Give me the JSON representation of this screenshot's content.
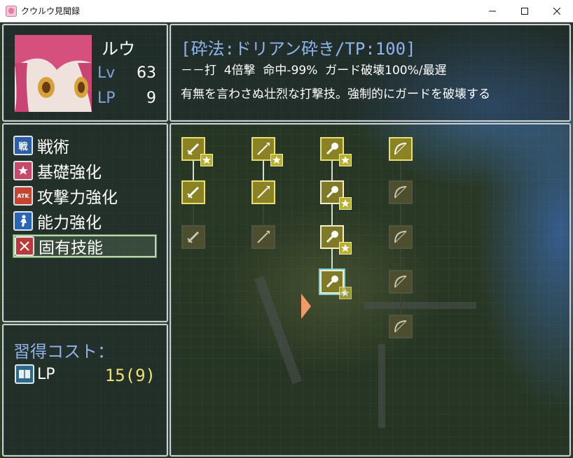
{
  "window": {
    "title": "クウルウ見聞録"
  },
  "character": {
    "name": "ルウ",
    "lv_label": "Lv",
    "lv_value": "63",
    "lp_label": "LP",
    "lp_value": "9"
  },
  "skill": {
    "title": "[砕法:ドリアン砕き/TP:100]",
    "stats": "－－打  4倍撃  命中-99%  ガード破壊100%/最遅",
    "description": "有無を言わさぬ壮烈な打撃技。強制的にガードを破壊する"
  },
  "categories": [
    {
      "label": "戦術",
      "icon_text": "戦",
      "icon": "tactics-icon",
      "color": "#2c5da8"
    },
    {
      "label": "基礎強化",
      "icon_text": "",
      "icon": "basic-enhance-icon",
      "color": "#c8486a"
    },
    {
      "label": "攻撃力強化",
      "icon_text": "ATK",
      "icon": "attack-enhance-icon",
      "color": "#c84432"
    },
    {
      "label": "能力強化",
      "icon_text": "",
      "icon": "ability-enhance-icon",
      "color": "#2a66b8"
    },
    {
      "label": "固有技能",
      "icon_text": "",
      "icon": "unique-skill-icon",
      "color": "#b83a3a"
    }
  ],
  "selected_category": "固有技能",
  "cost": {
    "title": "習得コスト：",
    "label": "LP",
    "value": "15(9)"
  },
  "tree": {
    "columns": [
      {
        "weapon": "sword",
        "nodes": [
          "learned-star",
          "learned",
          "dark"
        ]
      },
      {
        "weapon": "spear",
        "nodes": [
          "learned-star",
          "learned",
          "dark"
        ]
      },
      {
        "weapon": "mace",
        "nodes": [
          "learned-star",
          "lit-star",
          "lit-star",
          "cursor-star"
        ]
      },
      {
        "weapon": "bow",
        "nodes": [
          "learned",
          "dark",
          "dark",
          "dark",
          "dark"
        ]
      }
    ]
  },
  "colors": {
    "accent_text": "#8fb4ec",
    "cost_value": "#f0e070",
    "cursor_arrow": "#f09a6a"
  }
}
